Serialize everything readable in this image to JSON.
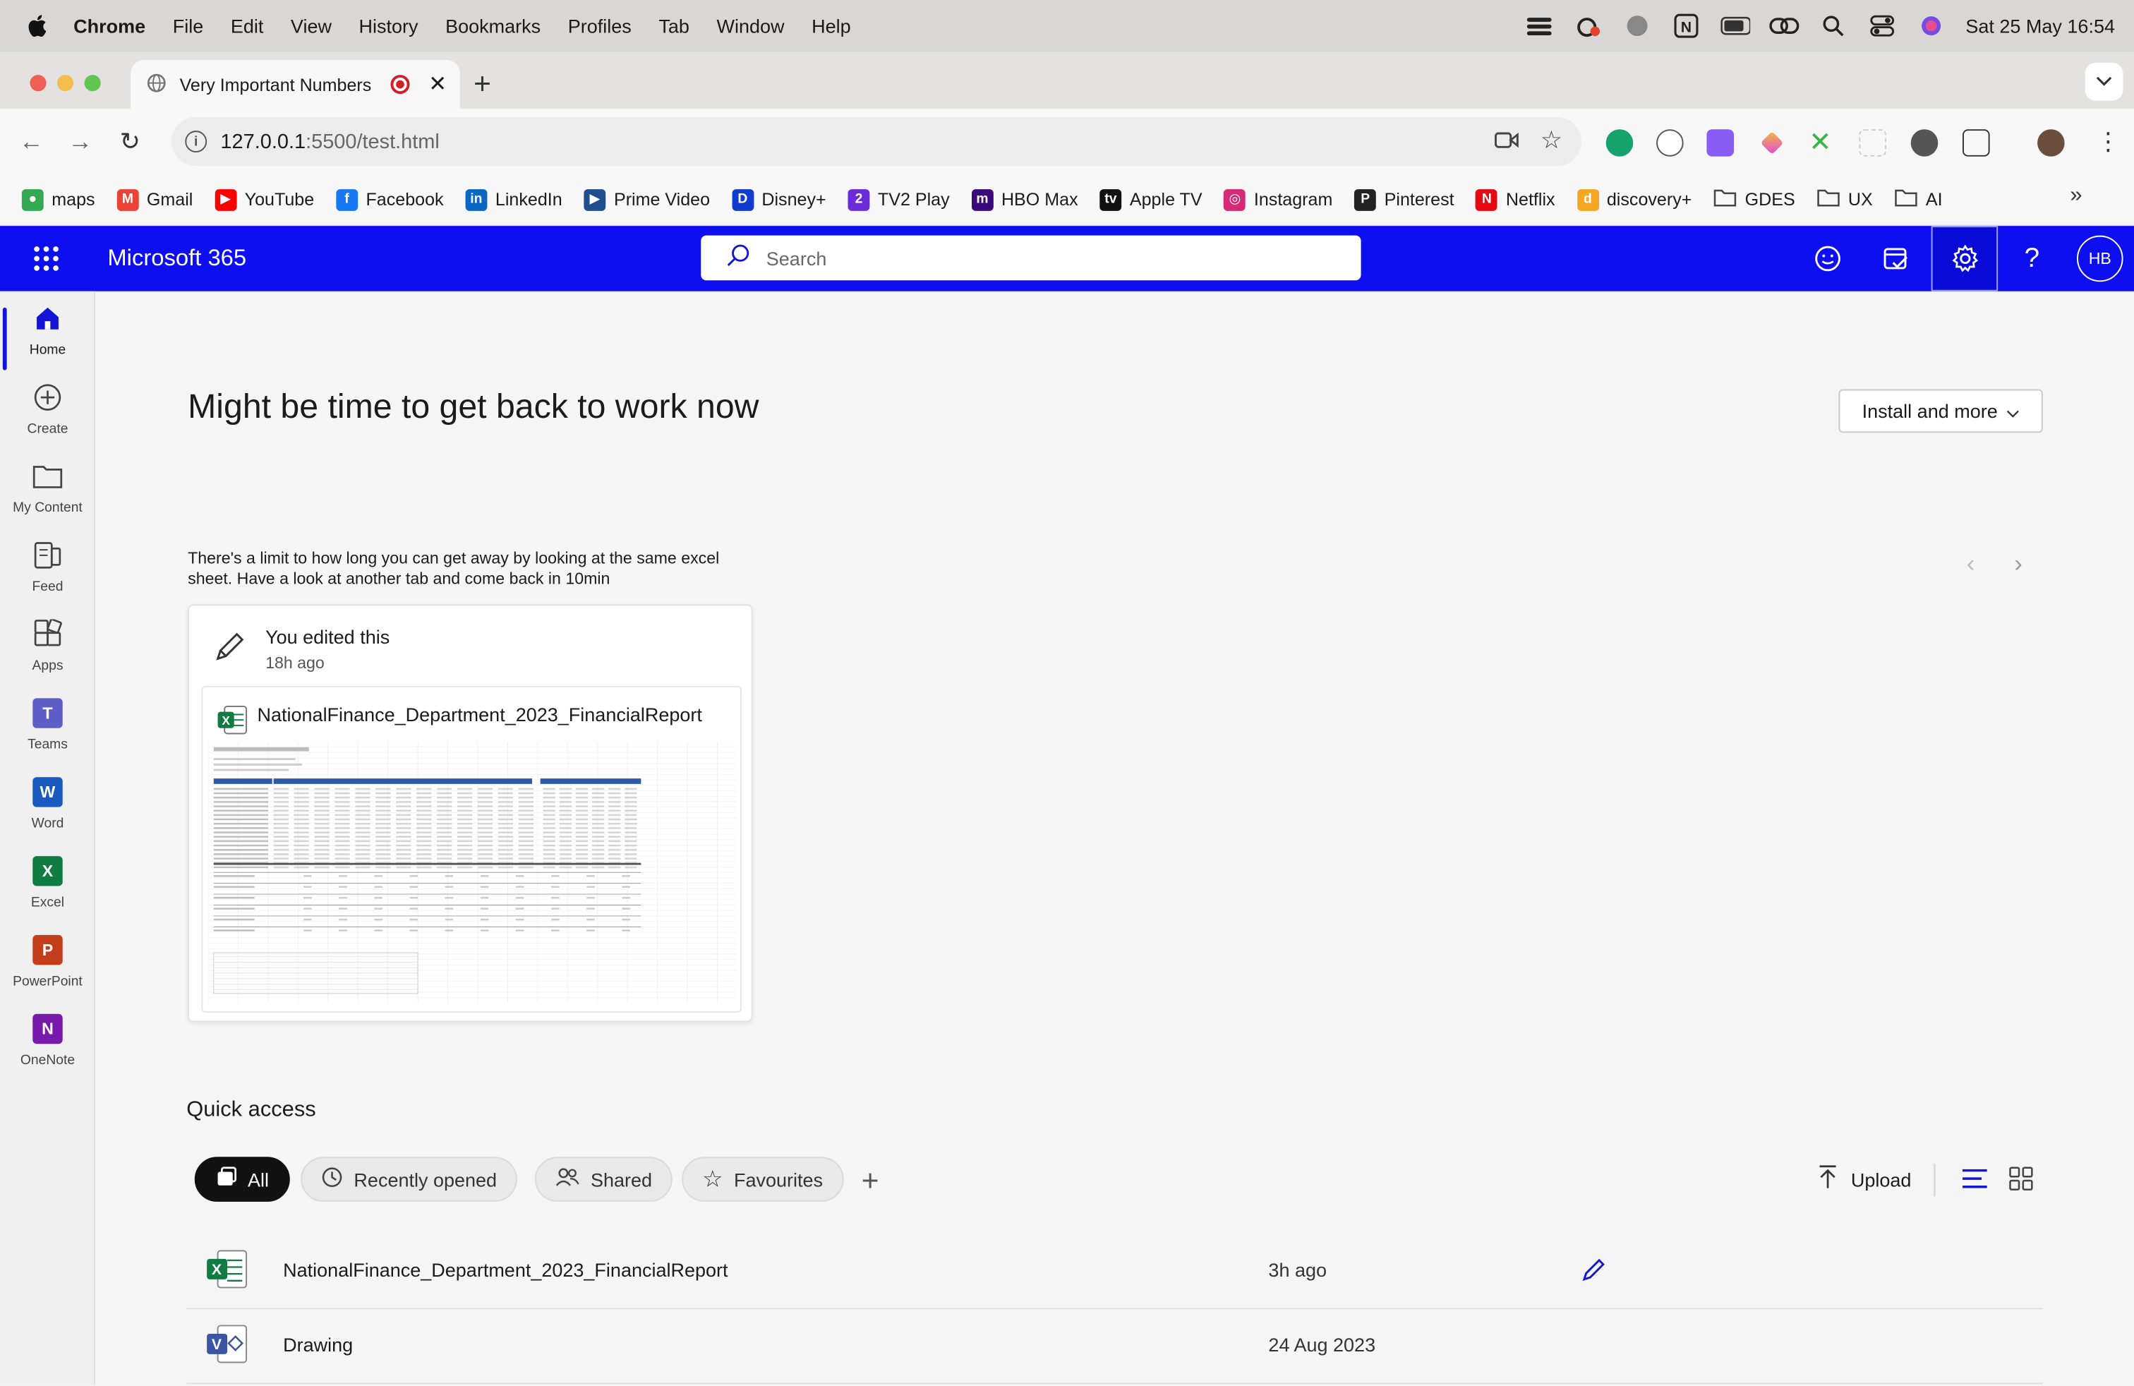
{
  "menubar": {
    "app": "Chrome",
    "items": [
      "File",
      "Edit",
      "View",
      "History",
      "Bookmarks",
      "Profiles",
      "Tab",
      "Window",
      "Help"
    ],
    "clock": "Sat 25 May  16:54"
  },
  "tab": {
    "title": "Very Important Numbers"
  },
  "address": {
    "host": "127.0.0.1",
    "path": ":5500/test.html"
  },
  "bookmarks": [
    {
      "label": "maps",
      "color": "#34a853",
      "glyph": "●"
    },
    {
      "label": "Gmail",
      "color": "#ea4335",
      "glyph": "M"
    },
    {
      "label": "YouTube",
      "color": "#ff0000",
      "glyph": "▶"
    },
    {
      "label": "Facebook",
      "color": "#1877f2",
      "glyph": "f"
    },
    {
      "label": "LinkedIn",
      "color": "#0a66c2",
      "glyph": "in"
    },
    {
      "label": "Prime Video",
      "color": "#1f4f8f",
      "glyph": "▶"
    },
    {
      "label": "Disney+",
      "color": "#113ccf",
      "glyph": "D"
    },
    {
      "label": "TV2 Play",
      "color": "#6c2bd9",
      "glyph": "2"
    },
    {
      "label": "HBO Max",
      "color": "#3b0a7a",
      "glyph": "m"
    },
    {
      "label": "Apple TV",
      "color": "#111111",
      "glyph": "tv"
    },
    {
      "label": "Instagram",
      "color": "#d62976",
      "glyph": "◎"
    },
    {
      "label": "Pinterest",
      "color": "#222222",
      "glyph": "P"
    },
    {
      "label": "Netflix",
      "color": "#e50914",
      "glyph": "N"
    },
    {
      "label": "discovery+",
      "color": "#f5a623",
      "glyph": "d"
    },
    {
      "label": "GDES",
      "color": "folder",
      "glyph": ""
    },
    {
      "label": "UX",
      "color": "folder",
      "glyph": ""
    },
    {
      "label": "AI",
      "color": "folder",
      "glyph": ""
    }
  ],
  "m365": {
    "brand": "Microsoft 365",
    "search_placeholder": "Search",
    "avatar_initials": "HB",
    "accent": "#0d0ff0"
  },
  "rail": [
    {
      "label": "Home",
      "icon": "home-icon"
    },
    {
      "label": "Create",
      "icon": "plus-circle-icon"
    },
    {
      "label": "My Content",
      "icon": "folder-icon"
    },
    {
      "label": "Feed",
      "icon": "feed-icon"
    },
    {
      "label": "Apps",
      "icon": "apps-icon"
    },
    {
      "label": "Teams",
      "icon": "teams-icon",
      "color": "#5b5fc7",
      "letter": "T"
    },
    {
      "label": "Word",
      "icon": "word-icon",
      "color": "#185abd",
      "letter": "W"
    },
    {
      "label": "Excel",
      "icon": "excel-icon",
      "color": "#107c41",
      "letter": "X"
    },
    {
      "label": "PowerPoint",
      "icon": "powerpoint-icon",
      "color": "#c43e1c",
      "letter": "P"
    },
    {
      "label": "OneNote",
      "icon": "onenote-icon",
      "color": "#7719aa",
      "letter": "N"
    }
  ],
  "main": {
    "heading": "Might be time to get back to work now",
    "install_label": "Install and more",
    "recommendation_text": "There's a limit to how long you can get away by looking at the same excel sheet. Have a look at another tab and come back in 10min",
    "card": {
      "activity": "You edited this",
      "time": "18h ago",
      "file_name": "NationalFinance_Department_2023_FinancialReport"
    },
    "quick_access": {
      "title": "Quick access",
      "filters": [
        "All",
        "Recently opened",
        "Shared",
        "Favourites"
      ],
      "upload_label": "Upload",
      "files": [
        {
          "name": "NationalFinance_Department_2023_FinancialReport",
          "date": "3h ago",
          "type": "excel"
        },
        {
          "name": "Drawing",
          "date": "24 Aug 2023",
          "type": "visio"
        }
      ]
    }
  }
}
